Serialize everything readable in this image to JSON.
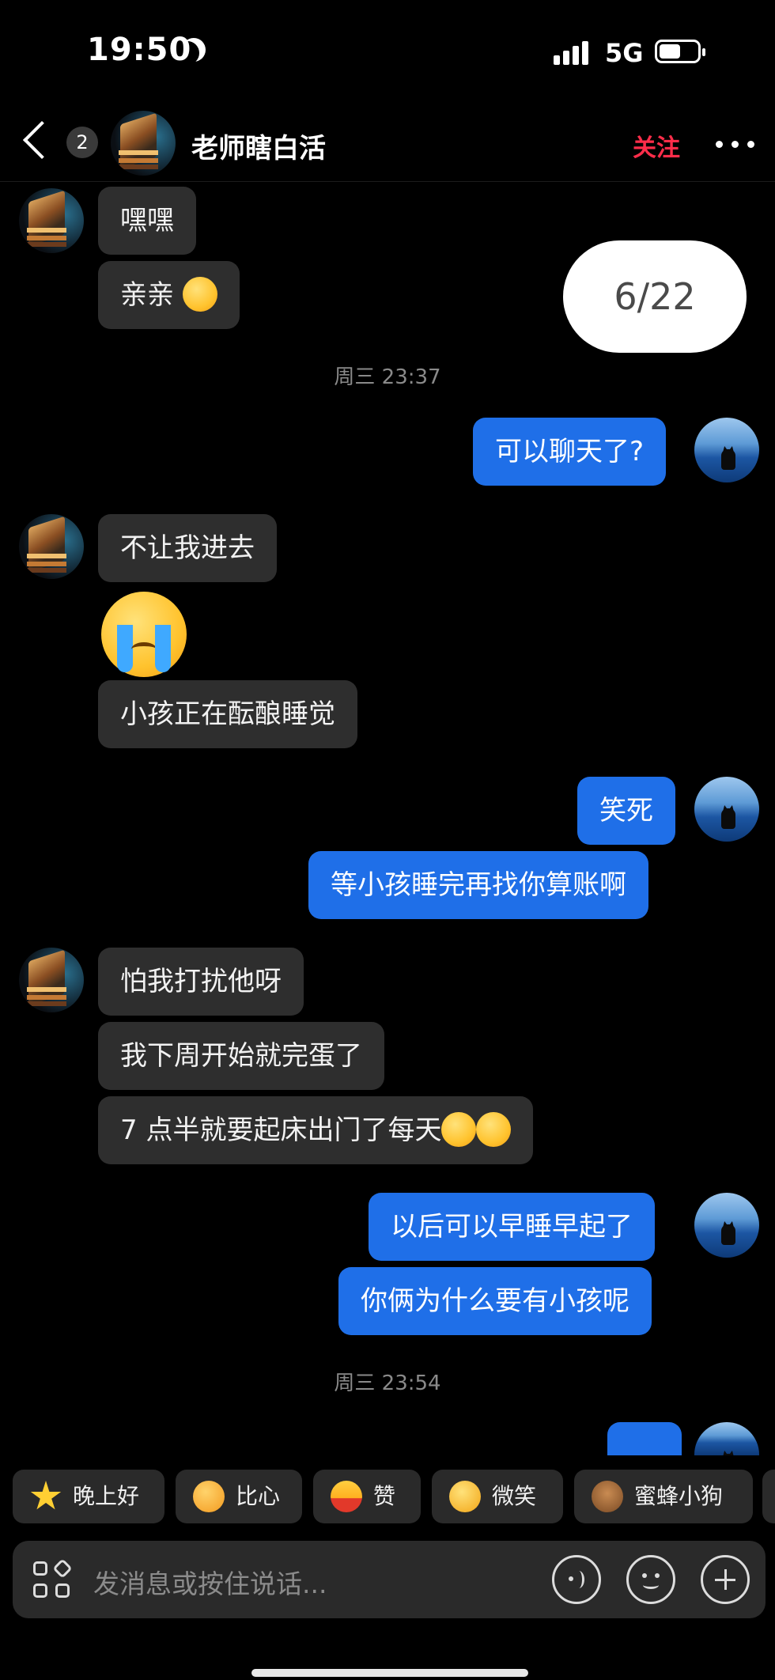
{
  "status_bar": {
    "time": "19:50",
    "network": "5G",
    "icons": [
      "moon-icon",
      "signal-icon",
      "battery-icon"
    ]
  },
  "header": {
    "unread_count": "2",
    "contact_name": "老师瞎白活",
    "follow_label": "关注",
    "icons": [
      "back-icon",
      "more-icon"
    ]
  },
  "page_counter": "6/22",
  "messages": [
    {
      "from": "them",
      "text": "嘿嘿"
    },
    {
      "from": "them",
      "text": "亲亲"
    },
    {
      "type": "time",
      "text": "周三 23:37"
    },
    {
      "from": "me",
      "text": "可以聊天了?"
    },
    {
      "from": "them",
      "text": "不让我进去"
    },
    {
      "from": "them",
      "type": "sticker",
      "icon": "crying-face-emoji"
    },
    {
      "from": "them",
      "text": "小孩正在酝酿睡觉"
    },
    {
      "from": "me",
      "text": "笑死"
    },
    {
      "from": "me",
      "text": "等小孩睡完再找你算账啊"
    },
    {
      "from": "them",
      "text": "怕我打扰他呀"
    },
    {
      "from": "them",
      "text": "我下周开始就完蛋了"
    },
    {
      "from": "them",
      "text": "7 点半就要起床出门了每天"
    },
    {
      "from": "me",
      "text": "以后可以早睡早起了"
    },
    {
      "from": "me",
      "text": "你俩为什么要有小孩呢"
    },
    {
      "type": "time",
      "text": "周三 23:54"
    }
  ],
  "quick_replies": [
    "晚上好",
    "比心",
    "赞",
    "微笑",
    "蜜蜂小狗"
  ],
  "composer": {
    "placeholder": "发消息或按住说话...",
    "icons": [
      "apps-icon",
      "voice-icon",
      "emoji-icon",
      "plus-icon"
    ]
  },
  "colors": {
    "outgoing_bubble": "#1f6fe8",
    "incoming_bubble": "#2e2e2e",
    "follow": "#ff2d4a",
    "background": "#000000"
  }
}
